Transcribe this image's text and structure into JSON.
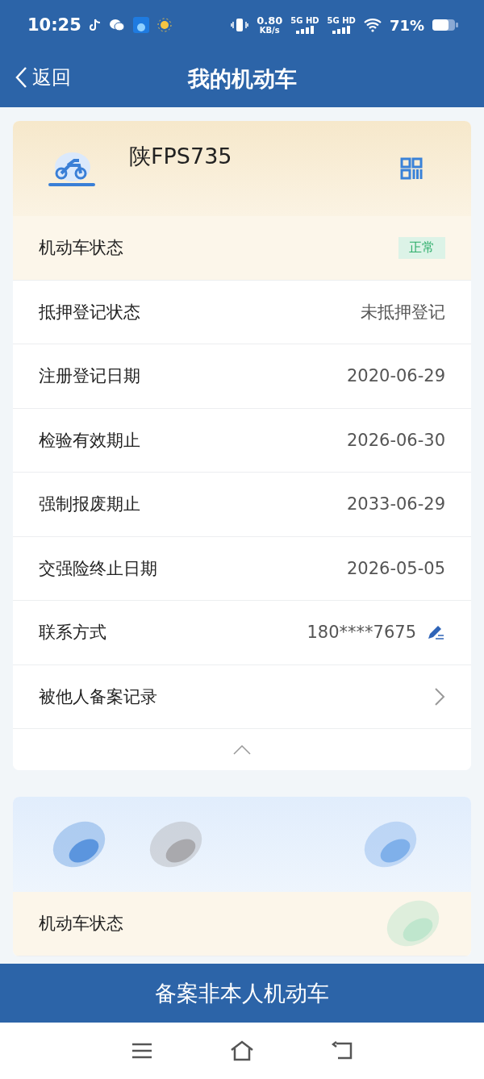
{
  "status_bar": {
    "time": "10:25",
    "net_speed": "0.80",
    "net_unit": "KB/s",
    "signals": [
      "5G HD",
      "5G HD"
    ],
    "battery": "71%"
  },
  "header": {
    "back": "返回",
    "title": "我的机动车"
  },
  "vehicles": [
    {
      "plate": "陕FPS735",
      "expanded": true,
      "rows": [
        {
          "kind": "badge",
          "label": "机动车状态",
          "value": "正常"
        },
        {
          "kind": "text",
          "label": "抵押登记状态",
          "value": "未抵押登记"
        },
        {
          "kind": "text",
          "label": "注册登记日期",
          "value": "2020-06-29"
        },
        {
          "kind": "text",
          "label": "检验有效期止",
          "value": "2026-06-30"
        },
        {
          "kind": "text",
          "label": "强制报废期止",
          "value": "2033-06-29"
        },
        {
          "kind": "text",
          "label": "交强险终止日期",
          "value": "2026-05-05"
        },
        {
          "kind": "phone",
          "label": "联系方式",
          "value": "180****7675"
        },
        {
          "kind": "link",
          "label": "被他人备案记录"
        }
      ]
    },
    {
      "redacted": true,
      "rows": [
        {
          "kind": "badge",
          "label": "机动车状态"
        }
      ]
    }
  ],
  "footer_button": "备案非本人机动车"
}
